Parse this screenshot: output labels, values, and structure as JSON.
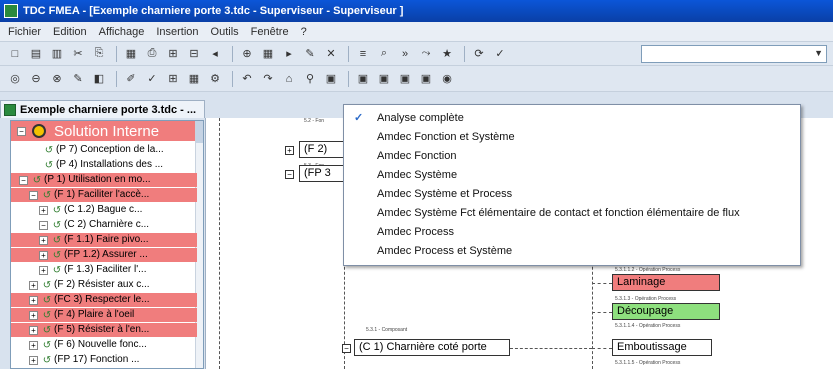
{
  "window": {
    "title": "TDC FMEA - [Exemple charniere porte 3.tdc - Superviseur - Superviseur ]"
  },
  "menu": [
    "Fichier",
    "Edition",
    "Affichage",
    "Insertion",
    "Outils",
    "Fenêtre",
    "?"
  ],
  "toolbar1_icons": [
    "new-icon",
    "open-icon",
    "save-icon",
    "cut-icon",
    "copy-icon",
    "paste-icon",
    "print-icon",
    "tree-icon",
    "tree2-icon",
    "nav-left-icon",
    "insert-icon",
    "grid-icon",
    "play-icon",
    "pin-icon",
    "hide-icon",
    "list-icon",
    "zoom-icon",
    "forward-icon",
    "branch-icon",
    "star-icon",
    "refresh-icon",
    "spellcheck-icon"
  ],
  "toolbar2_icons": [
    "zoom-in-icon",
    "zoom-out-icon",
    "zoom-fit-icon",
    "edit-icon",
    "chart-icon",
    "draw-icon",
    "check-icon",
    "tree-view-icon",
    "table-icon",
    "settings-icon",
    "undo-icon",
    "redo-icon",
    "tag-icon",
    "filter-icon",
    "view1-icon",
    "view2-icon",
    "view3-icon",
    "view4-icon",
    "view5-icon",
    "globe-icon"
  ],
  "combo": {
    "value": ""
  },
  "document_tab": {
    "label": "Exemple charniere porte 3.tdc - ..."
  },
  "tree": {
    "root_label": "Solution Interne",
    "rows": [
      {
        "label": "(P 7) Conception de la...",
        "red": false,
        "exp": "",
        "indent": 1
      },
      {
        "label": "(P 4) Installations des ...",
        "red": false,
        "exp": "",
        "indent": 1
      },
      {
        "label": "(P 1) Utilisation en mo...",
        "red": true,
        "exp": "−",
        "indent": 0
      },
      {
        "label": "(F 1) Faciliter l'accè...",
        "red": true,
        "exp": "−",
        "indent": 1
      },
      {
        "label": "(C 1.2) Bague c...",
        "red": false,
        "exp": "+",
        "indent": 2
      },
      {
        "label": "(C 2) Charnière c...",
        "red": false,
        "exp": "−",
        "indent": 2
      },
      {
        "label": "(F 1.1) Faire pivo...",
        "red": true,
        "exp": "+",
        "indent": 2
      },
      {
        "label": "(FP 1.2) Assurer ...",
        "red": true,
        "exp": "+",
        "indent": 2
      },
      {
        "label": "(F 1.3) Faciliter l'...",
        "red": false,
        "exp": "+",
        "indent": 2
      },
      {
        "label": "(F 2) Résister aux c...",
        "red": false,
        "exp": "+",
        "indent": 1
      },
      {
        "label": "(FC 3) Respecter le...",
        "red": true,
        "exp": "+",
        "indent": 1
      },
      {
        "label": "(F 4) Plaire à l'oeil",
        "red": true,
        "exp": "+",
        "indent": 1
      },
      {
        "label": "(F 5) Résister à l'en...",
        "red": true,
        "exp": "+",
        "indent": 1
      },
      {
        "label": "(F 6) Nouvelle fonc...",
        "red": false,
        "exp": "+",
        "indent": 1
      },
      {
        "label": "(FP 17) Fonction ...",
        "red": false,
        "exp": "+",
        "indent": 1
      }
    ]
  },
  "canvas": {
    "labels_small": [
      "5.2 - Fon",
      "5.3 - Fon",
      "5.3.1.1.2 - Opération Process",
      "5.3.1.3 - Opération Process",
      "5.3.1.1.4 - Opération Process",
      "5.3.1.1.5 - Opération Process",
      "5.3.1 - Composant"
    ],
    "nodes": {
      "f2": "(F 2)",
      "fp3": "(FP 3",
      "laminage": "Laminage",
      "decoupage": "Découpage",
      "emboutissage": "Emboutissage",
      "c1": "(C 1) Charnière coté porte"
    }
  },
  "dropdown": {
    "items": [
      {
        "label": "Analyse complète",
        "checked": true
      },
      {
        "label": "Amdec Fonction et Système",
        "checked": false
      },
      {
        "label": "Amdec Fonction",
        "checked": false
      },
      {
        "label": "Amdec Système",
        "checked": false
      },
      {
        "label": "Amdec Système et Process",
        "checked": false
      },
      {
        "label": "Amdec Système Fct élémentaire de contact et fonction élémentaire de flux",
        "checked": false
      },
      {
        "label": "Amdec Process",
        "checked": false
      },
      {
        "label": "Amdec Process et Système",
        "checked": false
      }
    ],
    "check_glyph": "✓"
  },
  "colors": {
    "node_red": "#f07d7d",
    "node_green": "#8ee07e",
    "title_blue": "#0b56d8"
  }
}
